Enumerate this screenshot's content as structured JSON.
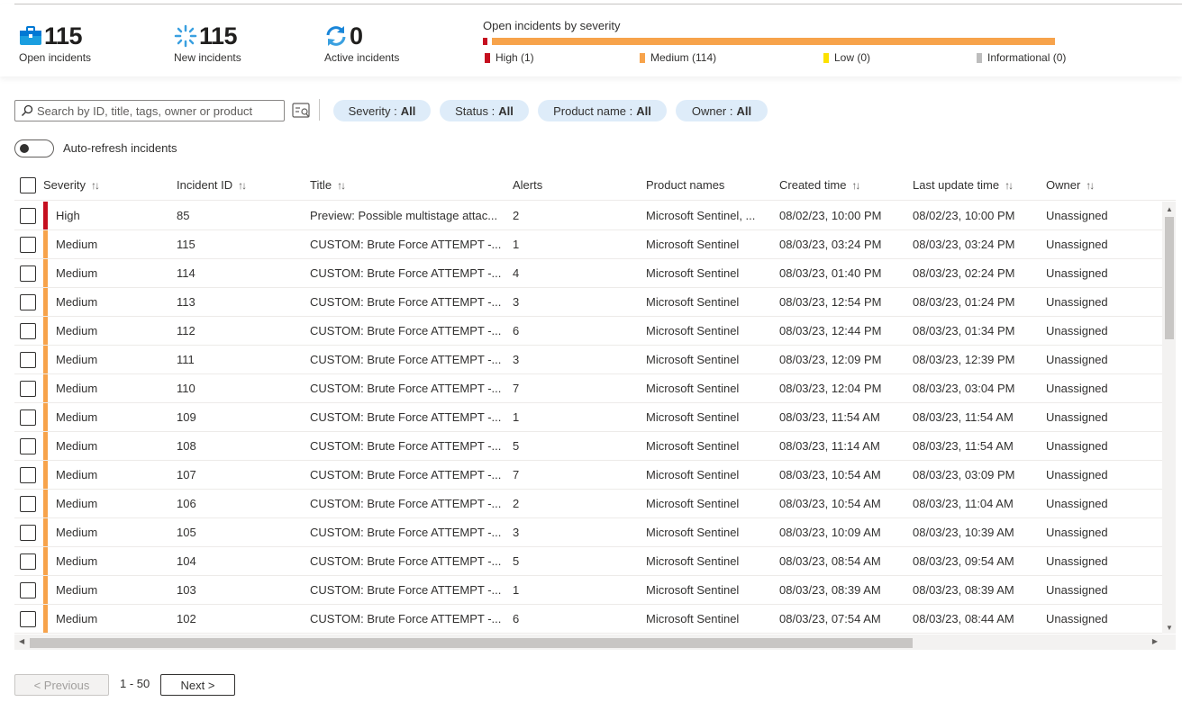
{
  "summary": {
    "open": {
      "value": "115",
      "label": "Open incidents"
    },
    "new": {
      "value": "115",
      "label": "New incidents"
    },
    "active": {
      "value": "0",
      "label": "Active incidents"
    },
    "severity_title": "Open incidents by severity",
    "legend": [
      {
        "label": "High (1)",
        "color": "#c50f1f"
      },
      {
        "label": "Medium (114)",
        "color": "#f7a34b"
      },
      {
        "label": "Low (0)",
        "color": "#fce100"
      },
      {
        "label": "Informational (0)",
        "color": "#bdbdbd"
      }
    ],
    "severity_counts": {
      "high": 1,
      "medium": 114,
      "low": 0,
      "informational": 0
    }
  },
  "toolbar": {
    "search_placeholder": "Search by ID, title, tags, owner or product",
    "filters": [
      {
        "name": "Severity",
        "value": "All"
      },
      {
        "name": "Status",
        "value": "All"
      },
      {
        "name": "Product name",
        "value": "All"
      },
      {
        "name": "Owner",
        "value": "All"
      }
    ],
    "auto_refresh_label": "Auto-refresh incidents"
  },
  "columns": [
    "Severity",
    "Incident ID",
    "Title",
    "Alerts",
    "Product names",
    "Created time",
    "Last update time",
    "Owner"
  ],
  "severity_colors": {
    "High": "#c50f1f",
    "Medium": "#f7a34b"
  },
  "rows": [
    {
      "severity": "High",
      "id": "85",
      "title": "Preview: Possible multistage attac...",
      "alerts": "2",
      "product": "Microsoft Sentinel, ...",
      "created": "08/02/23, 10:00 PM",
      "updated": "08/02/23, 10:00 PM",
      "owner": "Unassigned"
    },
    {
      "severity": "Medium",
      "id": "115",
      "title": "CUSTOM: Brute Force ATTEMPT -...",
      "alerts": "1",
      "product": "Microsoft Sentinel",
      "created": "08/03/23, 03:24 PM",
      "updated": "08/03/23, 03:24 PM",
      "owner": "Unassigned"
    },
    {
      "severity": "Medium",
      "id": "114",
      "title": "CUSTOM: Brute Force ATTEMPT -...",
      "alerts": "4",
      "product": "Microsoft Sentinel",
      "created": "08/03/23, 01:40 PM",
      "updated": "08/03/23, 02:24 PM",
      "owner": "Unassigned"
    },
    {
      "severity": "Medium",
      "id": "113",
      "title": "CUSTOM: Brute Force ATTEMPT -...",
      "alerts": "3",
      "product": "Microsoft Sentinel",
      "created": "08/03/23, 12:54 PM",
      "updated": "08/03/23, 01:24 PM",
      "owner": "Unassigned"
    },
    {
      "severity": "Medium",
      "id": "112",
      "title": "CUSTOM: Brute Force ATTEMPT -...",
      "alerts": "6",
      "product": "Microsoft Sentinel",
      "created": "08/03/23, 12:44 PM",
      "updated": "08/03/23, 01:34 PM",
      "owner": "Unassigned"
    },
    {
      "severity": "Medium",
      "id": "111",
      "title": "CUSTOM: Brute Force ATTEMPT -...",
      "alerts": "3",
      "product": "Microsoft Sentinel",
      "created": "08/03/23, 12:09 PM",
      "updated": "08/03/23, 12:39 PM",
      "owner": "Unassigned"
    },
    {
      "severity": "Medium",
      "id": "110",
      "title": "CUSTOM: Brute Force ATTEMPT -...",
      "alerts": "7",
      "product": "Microsoft Sentinel",
      "created": "08/03/23, 12:04 PM",
      "updated": "08/03/23, 03:04 PM",
      "owner": "Unassigned"
    },
    {
      "severity": "Medium",
      "id": "109",
      "title": "CUSTOM: Brute Force ATTEMPT -...",
      "alerts": "1",
      "product": "Microsoft Sentinel",
      "created": "08/03/23, 11:54 AM",
      "updated": "08/03/23, 11:54 AM",
      "owner": "Unassigned"
    },
    {
      "severity": "Medium",
      "id": "108",
      "title": "CUSTOM: Brute Force ATTEMPT -...",
      "alerts": "5",
      "product": "Microsoft Sentinel",
      "created": "08/03/23, 11:14 AM",
      "updated": "08/03/23, 11:54 AM",
      "owner": "Unassigned"
    },
    {
      "severity": "Medium",
      "id": "107",
      "title": "CUSTOM: Brute Force ATTEMPT -...",
      "alerts": "7",
      "product": "Microsoft Sentinel",
      "created": "08/03/23, 10:54 AM",
      "updated": "08/03/23, 03:09 PM",
      "owner": "Unassigned"
    },
    {
      "severity": "Medium",
      "id": "106",
      "title": "CUSTOM: Brute Force ATTEMPT -...",
      "alerts": "2",
      "product": "Microsoft Sentinel",
      "created": "08/03/23, 10:54 AM",
      "updated": "08/03/23, 11:04 AM",
      "owner": "Unassigned"
    },
    {
      "severity": "Medium",
      "id": "105",
      "title": "CUSTOM: Brute Force ATTEMPT -...",
      "alerts": "3",
      "product": "Microsoft Sentinel",
      "created": "08/03/23, 10:09 AM",
      "updated": "08/03/23, 10:39 AM",
      "owner": "Unassigned"
    },
    {
      "severity": "Medium",
      "id": "104",
      "title": "CUSTOM: Brute Force ATTEMPT -...",
      "alerts": "5",
      "product": "Microsoft Sentinel",
      "created": "08/03/23, 08:54 AM",
      "updated": "08/03/23, 09:54 AM",
      "owner": "Unassigned"
    },
    {
      "severity": "Medium",
      "id": "103",
      "title": "CUSTOM: Brute Force ATTEMPT -...",
      "alerts": "1",
      "product": "Microsoft Sentinel",
      "created": "08/03/23, 08:39 AM",
      "updated": "08/03/23, 08:39 AM",
      "owner": "Unassigned"
    },
    {
      "severity": "Medium",
      "id": "102",
      "title": "CUSTOM: Brute Force ATTEMPT -...",
      "alerts": "6",
      "product": "Microsoft Sentinel",
      "created": "08/03/23, 07:54 AM",
      "updated": "08/03/23, 08:44 AM",
      "owner": "Unassigned"
    }
  ],
  "pager": {
    "previous": "< Previous",
    "range": "1 - 50",
    "next": "Next >"
  }
}
